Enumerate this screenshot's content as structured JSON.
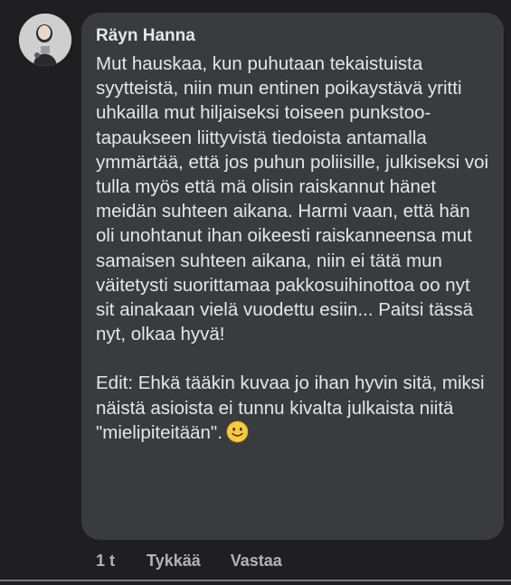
{
  "comment": {
    "author": "Räyn Hanna",
    "body": "Mut hauskaa, kun puhutaan tekaistuista syytteistä, niin mun entinen poikaystävä yritti uhkailla mut hiljaiseksi toiseen punkstoo-tapaukseen liittyvistä tiedoista antamalla ymmärtää, että jos puhun poliisille, julkiseksi voi tulla myös että mä olisin raiskannut hänet meidän suhteen aikana. Harmi vaan, että hän oli unohtanut ihan oikeesti raiskanneensa mut samaisen suhteen aikana, niin ei tätä mun väitetysti suorittamaa pakkosuihinottoa oo nyt sit ainakaan vielä vuodettu esiin... Paitsi tässä nyt, olkaa hyvä!",
    "edit": "Edit: Ehkä tääkin kuvaa jo ihan hyvin sitä, miksi näistä asioista ei tunnu kivalta julkaista niitä \"mielipiteitään\".",
    "emoji_icon": "slightly-smiling-face-icon"
  },
  "actions": {
    "time": "1 t",
    "like": "Tykkää",
    "reply": "Vastaa"
  },
  "colors": {
    "background": "#1f1f21",
    "bubble": "#3a3b3c",
    "text": "#e4e6eb",
    "muted": "#b0b3b8"
  }
}
